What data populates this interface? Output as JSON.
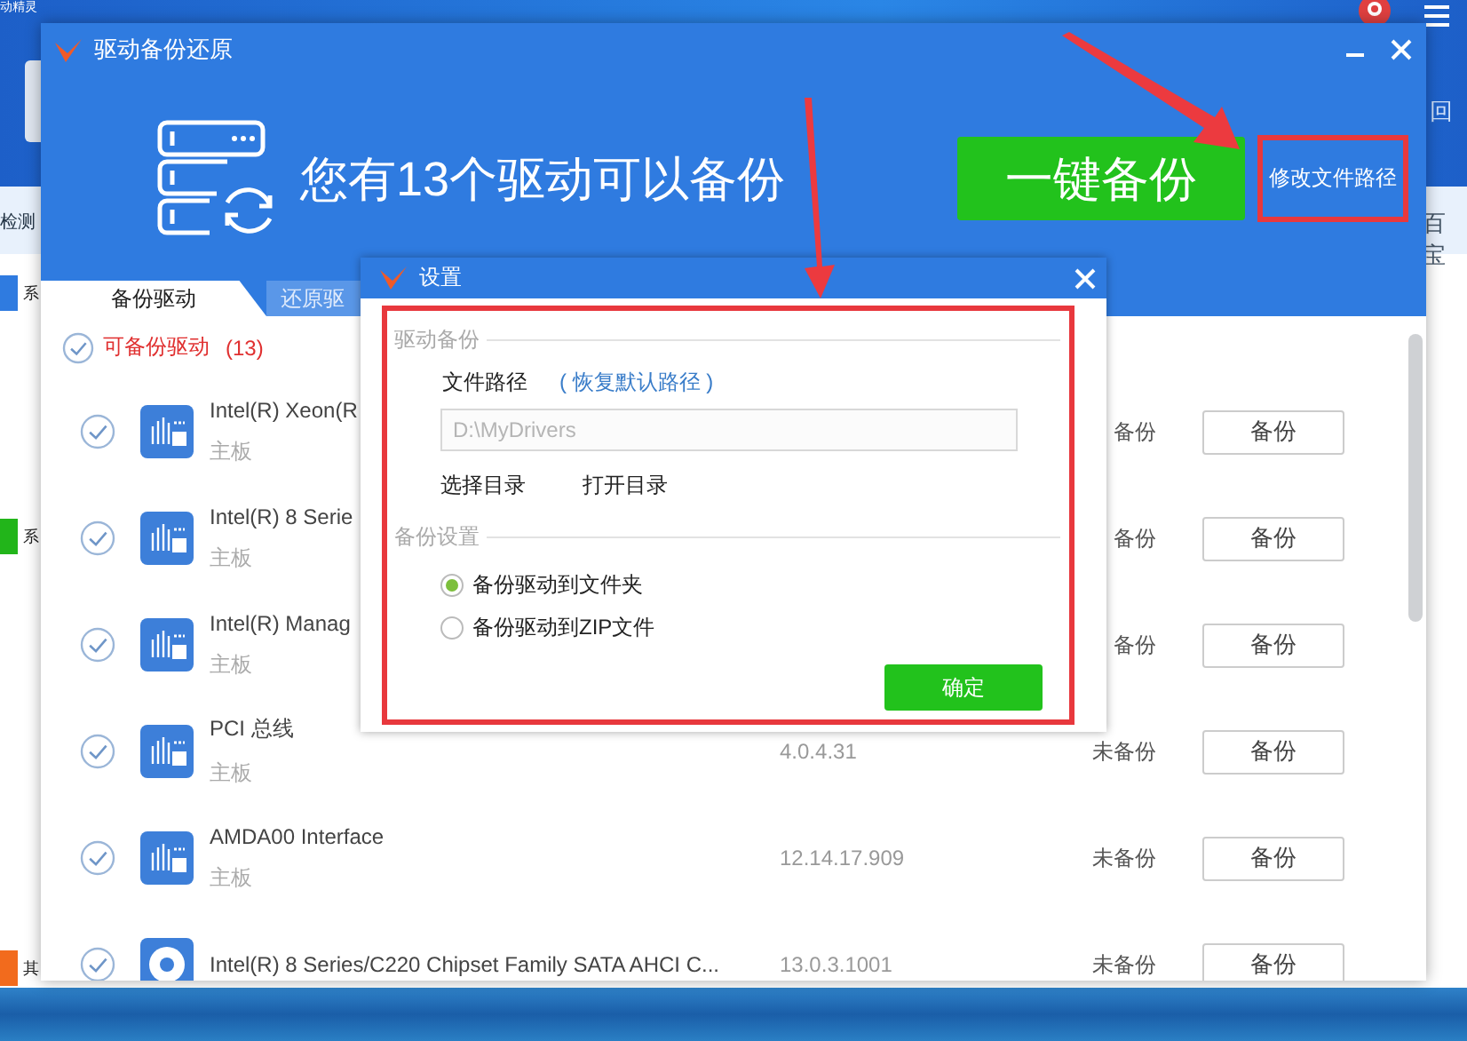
{
  "background_app": {
    "title": "动精灵",
    "tab": "检测",
    "right_label": "回",
    "right_tab": "百宝",
    "side_items": [
      {
        "label": "系",
        "color": "#2f7be0"
      },
      {
        "label": "系",
        "color": "#22b51a"
      },
      {
        "label": "其",
        "color": "#f26b1d"
      }
    ]
  },
  "dialog": {
    "title": "驱动备份还原",
    "headline": "您有13个驱动可以备份",
    "primary_button": "一键备份",
    "path_link": {
      "label": "修改文件路径",
      "highlighted": true
    },
    "tabs": [
      {
        "label": "备份驱动",
        "selected": true
      },
      {
        "label": "还原驱",
        "selected": false
      }
    ],
    "group": {
      "label": "可备份驱动",
      "count": "(13)",
      "checked": true
    },
    "drivers": [
      {
        "kind": "board",
        "name": "Intel(R) Xeon(R",
        "category": "主板",
        "status": "备份",
        "button": "备份",
        "checked": true
      },
      {
        "kind": "board",
        "name": "Intel(R) 8 Serie",
        "category": "主板",
        "status": "备份",
        "button": "备份",
        "checked": true
      },
      {
        "kind": "board",
        "name": "Intel(R) Manag",
        "category": "主板",
        "status": "备份",
        "button": "备份",
        "checked": true
      },
      {
        "kind": "board",
        "name": "PCI 总线",
        "category": "主板",
        "version": "4.0.4.31",
        "status": "未备份",
        "button": "备份",
        "checked": true
      },
      {
        "kind": "board",
        "name": "AMDA00 Interface",
        "category": "主板",
        "version": "12.14.17.909",
        "status": "未备份",
        "button": "备份",
        "checked": true
      },
      {
        "kind": "disk",
        "name": "Intel(R) 8 Series/C220 Chipset Family SATA AHCI C...",
        "version": "13.0.3.1001",
        "status": "未备份",
        "button": "备份",
        "checked": true
      }
    ]
  },
  "settings": {
    "title": "设置",
    "highlighted": true,
    "section_path": "驱动备份",
    "path_label": "文件路径",
    "restore_link": "( 恢复默认路径 )",
    "path_field": {
      "value": "D:\\MyDrivers",
      "disabled": true
    },
    "choose_dir": "选择目录",
    "open_dir": "打开目录",
    "section_mode": "备份设置",
    "options": [
      {
        "label": "备份驱动到文件夹",
        "selected": true
      },
      {
        "label": "备份驱动到ZIP文件",
        "selected": false
      }
    ],
    "confirm": "确定"
  }
}
